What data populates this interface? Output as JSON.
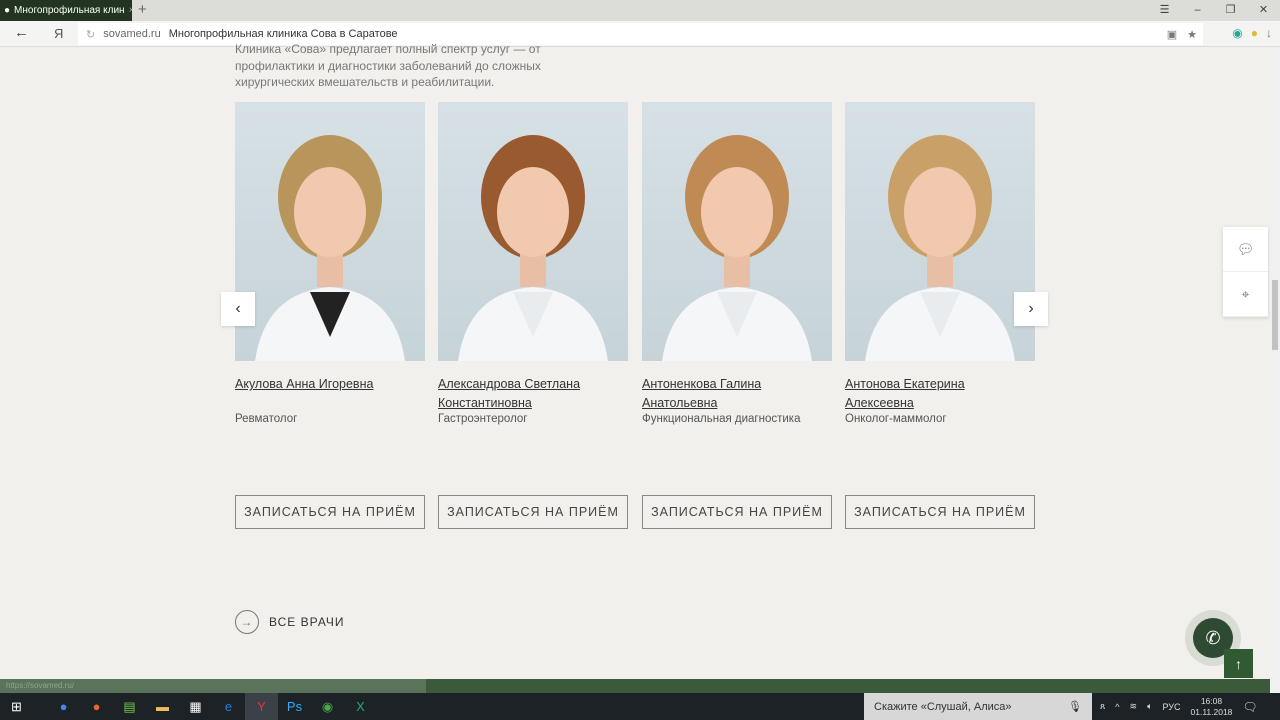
{
  "browser": {
    "tab_title": "Многопрофильная клиника Сова в Саратове",
    "tab_title_short": "Многопрофильная клин",
    "domain": "sovamed.ru",
    "page_title": "Многопрофильная клиника Сова в Саратове",
    "status_url": "https://sovamed.ru/",
    "ya": "Я"
  },
  "intro": "Клиника «Сова» предлагает полный спектр услуг — от профилактики и диагностики заболеваний до сложных хирургических вмешательств и реабилитации.",
  "doctors": [
    {
      "name": "Акулова Анна Игоревна",
      "specialty": "Ревматолог",
      "hair": "#b8955a",
      "top": "#222"
    },
    {
      "name": "Александрова Светлана Константиновна",
      "specialty": "Гастроэнтеролог",
      "hair": "#9a5a30",
      "top": "#e8ecee"
    },
    {
      "name": "Антоненкова Галина Анатольевна",
      "specialty": "Функциональная диагностика",
      "hair": "#c08a55",
      "top": "#e8ecee"
    },
    {
      "name": "Антонова Екатерина Алексеевна",
      "specialty": "Онколог-маммолог",
      "hair": "#c9a068",
      "top": "#e8ecee"
    }
  ],
  "book_label": "ЗАПИСАТЬСЯ НА ПРИЁМ",
  "all_doctors": "ВСЕ ВРАЧИ",
  "taskbar": {
    "search_placeholder": "Скажите «Слушай, Алиса»",
    "lang": "РУС",
    "time": "16:08",
    "date": "01.11.2018"
  }
}
